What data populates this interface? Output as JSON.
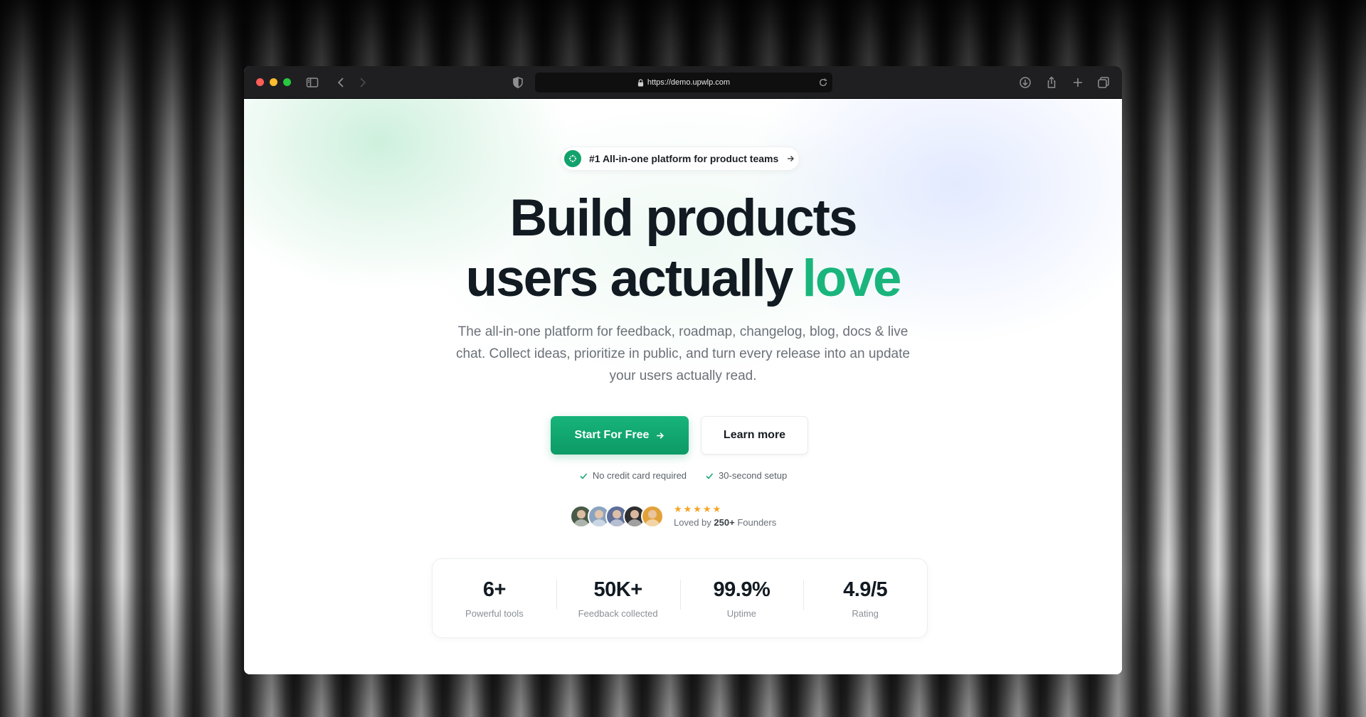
{
  "browser": {
    "url": "https://demo.upwlp.com",
    "icons": [
      "sidebar-icon",
      "back-icon",
      "forward-icon",
      "shield-icon",
      "lock-icon",
      "reload-icon",
      "download-icon",
      "share-icon",
      "new-tab-icon",
      "tabs-overview-icon"
    ],
    "traffic_light_colors": [
      "#ff5f57",
      "#febc2e",
      "#28c840"
    ]
  },
  "hero": {
    "pill_text": "#1 All-in-one platform for product teams",
    "headline_line1": "Build products",
    "headline_line2": "users actually",
    "headline_accent": "love",
    "accent_color": "#19b57c",
    "subtitle": "The all-in-one platform for feedback, roadmap, changelog, blog, docs & live chat. Collect ideas, prioritize in public, and turn every release into an update your users actually read.",
    "primary_cta": "Start For Free",
    "secondary_cta": "Learn more",
    "checks": [
      "No credit card required",
      "30-second setup"
    ],
    "stars": "★★★★★",
    "loved_prefix": "Loved by",
    "loved_count": "250+",
    "loved_suffix": "Founders"
  },
  "stats": [
    {
      "value": "6+",
      "label": "Powerful tools"
    },
    {
      "value": "50K+",
      "label": "Feedback collected"
    },
    {
      "value": "99.9%",
      "label": "Uptime"
    },
    {
      "value": "4.9/5",
      "label": "Rating"
    }
  ]
}
